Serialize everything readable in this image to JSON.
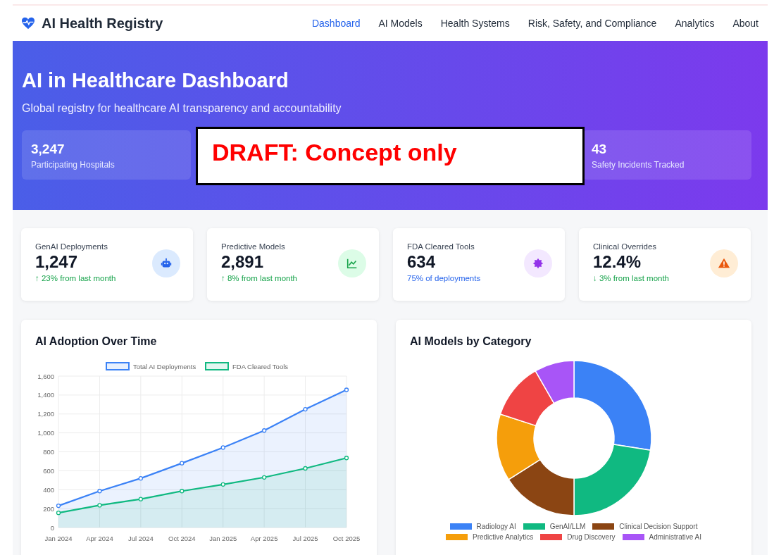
{
  "brand": {
    "name": "AI Health Registry"
  },
  "nav": [
    {
      "label": "Dashboard",
      "selected": true
    },
    {
      "label": "AI Models",
      "selected": false
    },
    {
      "label": "Health Systems",
      "selected": false
    },
    {
      "label": "Risk, Safety, and Compliance",
      "selected": false
    },
    {
      "label": "Analytics",
      "selected": false
    },
    {
      "label": "About",
      "selected": false
    }
  ],
  "hero": {
    "title": "AI in Healthcare Dashboard",
    "subtitle": "Global registry for healthcare AI transparency and accountability",
    "stats": [
      {
        "value": "3,247",
        "label": "Participating Hospitals"
      },
      {
        "value": "43",
        "label": "Safety Incidents Tracked"
      }
    ]
  },
  "overlay_note": "DRAFT: Concept only",
  "metrics": [
    {
      "label": "GenAI Deployments",
      "value": "1,247",
      "change": {
        "text": "↑ 23% from last month",
        "kind": "good"
      },
      "kind": "robot"
    },
    {
      "label": "Predictive Models",
      "value": "2,891",
      "change": {
        "text": "↑ 8% from last month",
        "kind": "good"
      },
      "kind": "chart"
    },
    {
      "label": "FDA Cleared Tools",
      "value": "634",
      "change": {
        "text": "75% of deployments",
        "kind": "info"
      },
      "kind": "seal"
    },
    {
      "label": "Clinical Overrides",
      "value": "12.4%",
      "change": {
        "text": "↓ 3% from last month",
        "kind": "good"
      },
      "kind": "warning"
    }
  ],
  "adoption": {
    "title": "AI Adoption Over Time",
    "chart_data": {
      "type": "area",
      "x": [
        "Jan 2024",
        "Apr 2024",
        "Jul 2024",
        "Oct 2024",
        "Jan 2025",
        "Apr 2025",
        "Jul 2025",
        "Oct 2025"
      ],
      "series": [
        {
          "name": "Total AI Deployments",
          "color": "#3b82f6",
          "values": [
            230,
            385,
            520,
            680,
            845,
            1025,
            1250,
            1455
          ]
        },
        {
          "name": "FDA Cleared Tools",
          "color": "#10b981",
          "values": [
            155,
            235,
            300,
            385,
            455,
            530,
            625,
            735
          ]
        }
      ],
      "ylim": [
        0,
        1600
      ],
      "grid": true,
      "legend": true,
      "yticks": [
        {
          "value": 0,
          "label": "0"
        },
        {
          "value": 200,
          "label": "200"
        },
        {
          "value": 400,
          "label": "400"
        },
        {
          "value": 600,
          "label": "600"
        },
        {
          "value": 800,
          "label": "800"
        },
        {
          "value": 1000,
          "label": "1,000"
        },
        {
          "value": 1200,
          "label": "1,200"
        },
        {
          "value": 1400,
          "label": "1,400"
        },
        {
          "value": 1600,
          "label": "1,600"
        }
      ]
    }
  },
  "categories": {
    "title": "AI Models by Category",
    "legend": [
      {
        "label": "Radiology AI",
        "color": "#3b82f6"
      },
      {
        "label": "GenAI/LLM",
        "color": "#10b981"
      },
      {
        "label": "Clinical Decision Support",
        "color": "#8b4513"
      },
      {
        "label": "Predictive Analytics",
        "color": "#f59e0b"
      },
      {
        "label": "Drug Discovery",
        "color": "#ef4444"
      },
      {
        "label": "Administrative AI",
        "color": "#a855f7"
      }
    ]
  }
}
